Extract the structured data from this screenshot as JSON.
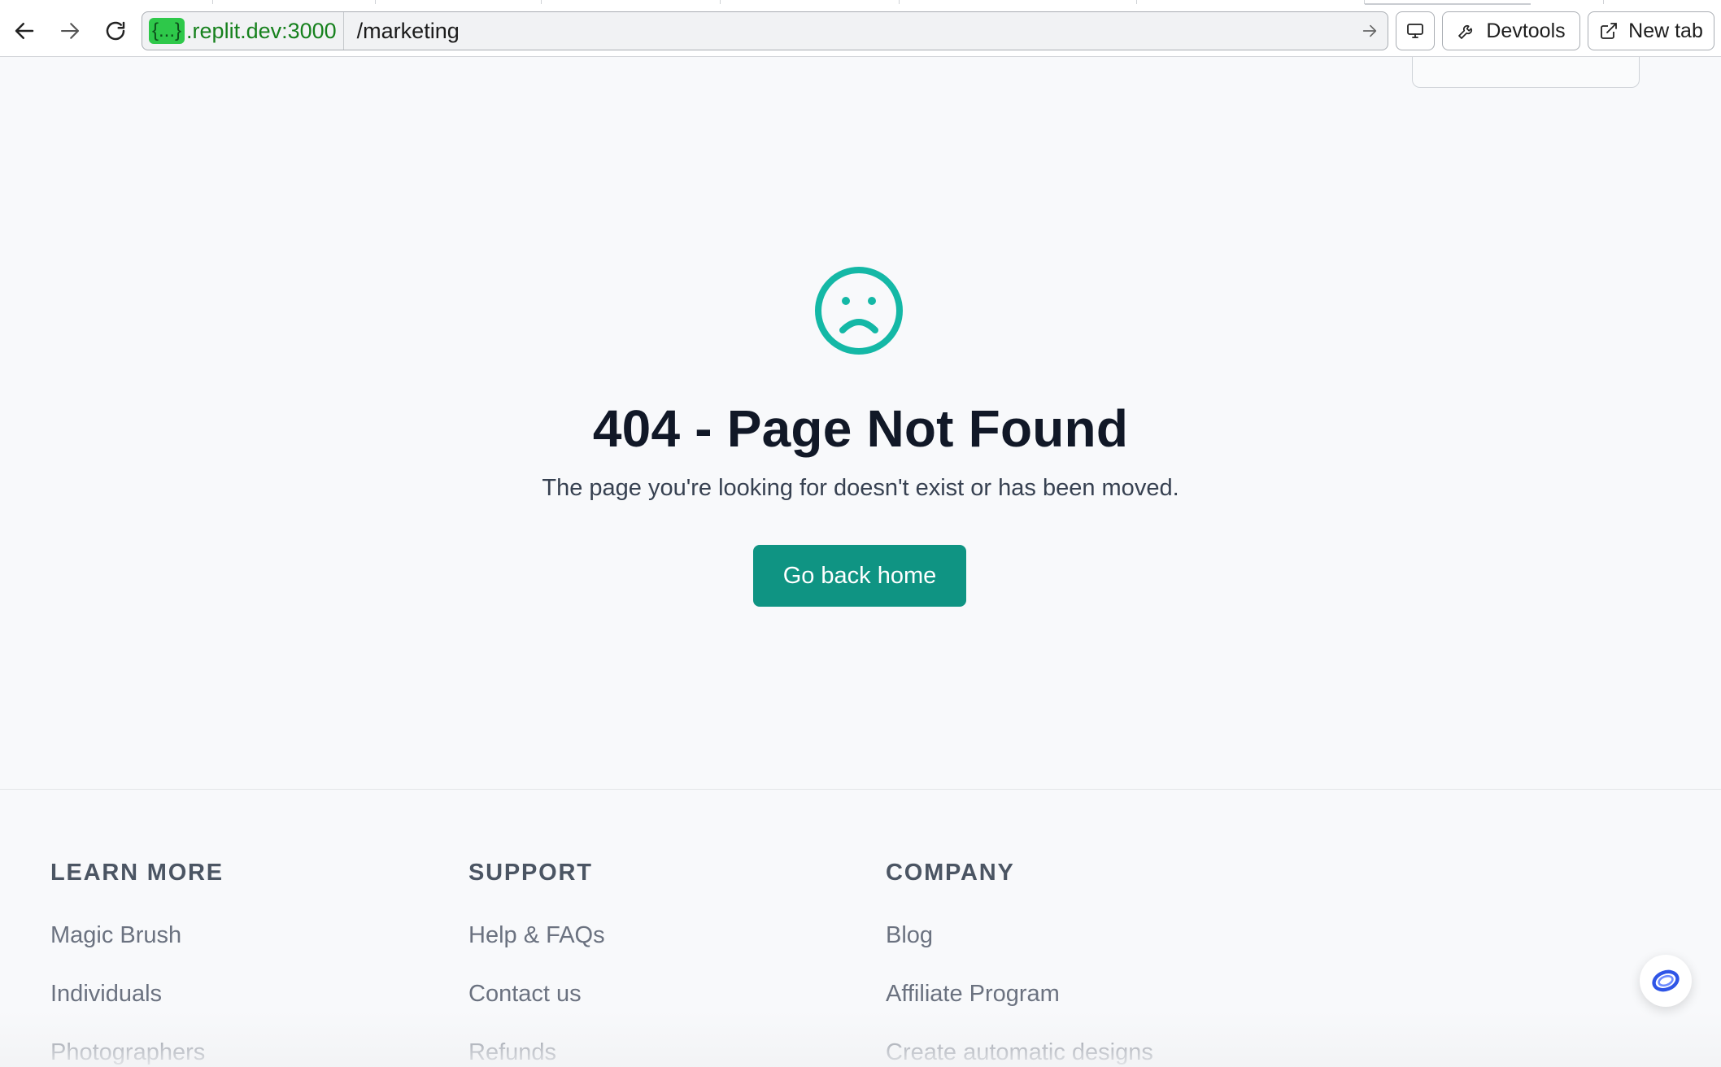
{
  "browser": {
    "address": {
      "host_badge": "{...}",
      "host_domain": ".replit.dev:3000",
      "path": "/marketing"
    },
    "devtools_label": "Devtools",
    "new_tab_label": "New tab",
    "colors": {
      "host_badge_bg": "#2ec84a",
      "host_domain": "#16811d"
    }
  },
  "error_page": {
    "icon": "sad-face-icon",
    "title": "404 - Page Not Found",
    "message": "The page you're looking for doesn't exist or has been moved.",
    "button_label": "Go back home",
    "colors": {
      "accent": "#14b8a6",
      "button": "#0f9483"
    }
  },
  "footer": {
    "columns": [
      {
        "heading": "LEARN MORE",
        "links": [
          "Magic Brush",
          "Individuals",
          "Photographers"
        ]
      },
      {
        "heading": "SUPPORT",
        "links": [
          "Help & FAQs",
          "Contact us",
          "Refunds"
        ]
      },
      {
        "heading": "COMPANY",
        "links": [
          "Blog",
          "Affiliate Program",
          "Create automatic designs"
        ]
      }
    ]
  },
  "chat_widget": {
    "icon": "chat-assistant-icon"
  }
}
